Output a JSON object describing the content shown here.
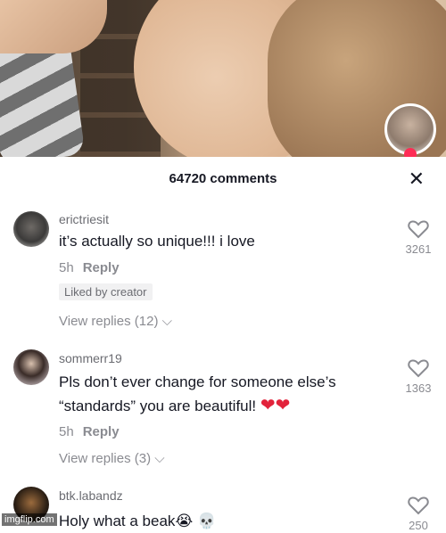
{
  "sheet": {
    "title": "64720 comments",
    "close_icon": "close-icon"
  },
  "comments": [
    {
      "username": "erictriesit",
      "text": "it’s actually so unique!!! i love",
      "time": "5h",
      "reply_label": "Reply",
      "badge": "Liked by creator",
      "view_replies": "View replies (12)",
      "likes": "3261"
    },
    {
      "username": "sommerr19",
      "text_line1": "Pls don’t ever change for someone else’s",
      "text_line2": "“standards” you are beautiful!",
      "time": "5h",
      "reply_label": "Reply",
      "view_replies": "View replies (3)",
      "likes": "1363"
    },
    {
      "username": "btk.labandz",
      "text": "Holy what a beak",
      "likes": "250"
    }
  ],
  "watermark": "imgflip.com",
  "colors": {
    "accent": "#fe2c55",
    "text": "#161823",
    "muted": "#8a8b91"
  }
}
